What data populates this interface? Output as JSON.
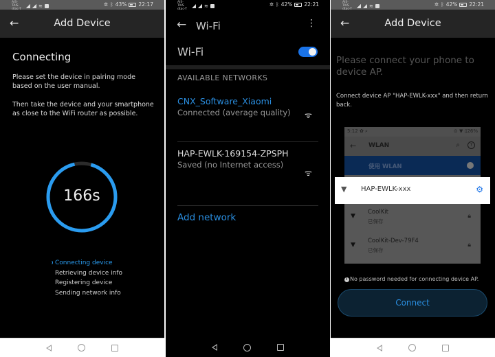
{
  "panel1": {
    "statusbar": {
      "carrier": "AIS-TAIS dtac-T",
      "battery": "43%",
      "time": "22:17"
    },
    "appbar": {
      "title": "Add Device",
      "back_icon": "arrow-left"
    },
    "heading": "Connecting",
    "instruction1": "Please set the device in pairing mode based on the user manual.",
    "instruction2": "Then take the device and your smartphone as close to the WiFi router as possible.",
    "countdown": {
      "label": "166s",
      "progress_fraction": 0.92,
      "color": "#2a9cf0"
    },
    "steps": [
      {
        "label": "Connecting device",
        "active": true
      },
      {
        "label": "Retrieving device info",
        "active": false
      },
      {
        "label": "Registering device",
        "active": false
      },
      {
        "label": "Sending network info",
        "active": false
      }
    ]
  },
  "panel2": {
    "statusbar": {
      "carrier": "AIS-TAIS dtac-T",
      "battery": "42%",
      "time": "22:21"
    },
    "appbar": {
      "title": "Wi-Fi",
      "back_icon": "arrow-left",
      "more_icon": "more-vertical"
    },
    "wifi_toggle": {
      "label": "Wi-Fi",
      "enabled": true
    },
    "section_header": "AVAILABLE NETWORKS",
    "networks": [
      {
        "ssid": "CNX_Software_Xiaomi",
        "status": "Connected (average quality)",
        "connected": true,
        "icon": "wifi-lock"
      },
      {
        "ssid": "HAP-EWLK-169154-ZPSPH",
        "status": "Saved (no Internet access)",
        "connected": false,
        "icon": "wifi"
      }
    ],
    "add_network": "Add network"
  },
  "panel3": {
    "statusbar": {
      "carrier": "AIS-TAIS dtac-T",
      "battery": "42%",
      "time": "22:21"
    },
    "appbar": {
      "title": "Add Device",
      "back_icon": "arrow-left"
    },
    "heading": "Please connect your phone to device AP.",
    "instruction": "Connect device AP \"HAP-EWLK-xxx\" and then return back.",
    "illustration": {
      "statusbar_left": "5:12 ✿ ⌕",
      "statusbar_right": "⊙ ▼ ▯26%",
      "title": "WLAN",
      "use_wlan": "使用 WLAN",
      "highlight_ssid": "HAP-EWLK-xxx",
      "networks": [
        {
          "ssid": "CoolKit",
          "status": "已保存"
        },
        {
          "ssid": "CoolKit-Dev-79F4",
          "status": "已保存"
        }
      ]
    },
    "note": "No password needed for connecting device AP.",
    "connect_button": "Connect"
  }
}
